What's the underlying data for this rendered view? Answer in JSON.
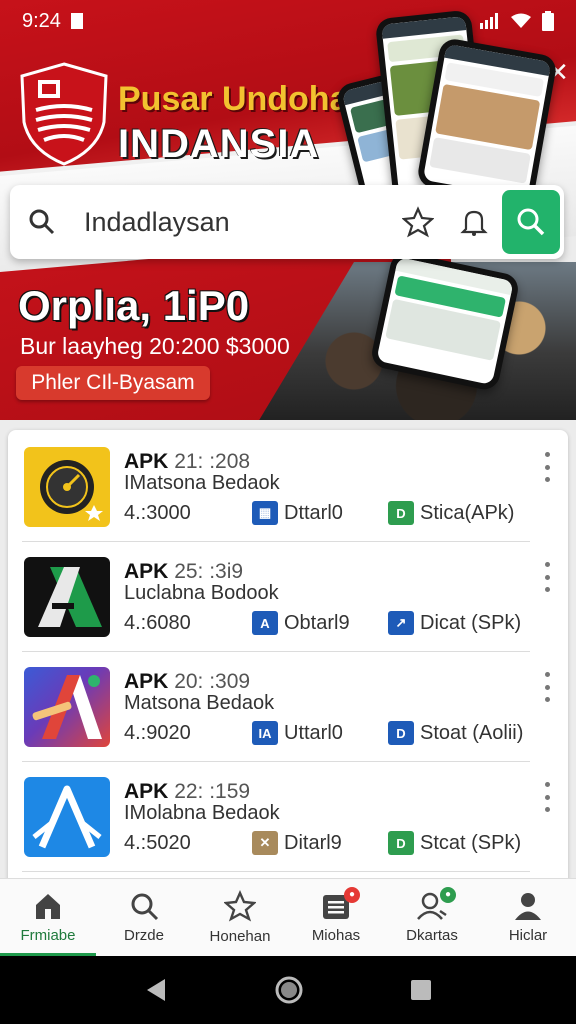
{
  "status_bar": {
    "time": "9:24"
  },
  "hero": {
    "brand_line1": "Pusar Undohan",
    "brand_line2": "INDANSIA",
    "promo_title": "Orplıa, 1iP0",
    "promo_subtitle": "Bur laayheg 20:200 $3000",
    "promo_button": "Phler CIl-Byasam"
  },
  "search": {
    "value": "Indadlaysan"
  },
  "apps": [
    {
      "title": "APK",
      "version": "21: :208",
      "developer": "IMatsona Bedaok",
      "size": "4.:3000",
      "tag1": "Dttarl0",
      "tag2": "Stica(APk)",
      "icon": "compass-icon",
      "icon_color": "#f2c31b"
    },
    {
      "title": "APK",
      "version": "25: :3i9",
      "developer": "Luclabna Bodook",
      "size": "4.:6080",
      "tag1": "Obtarl9",
      "tag2": "Dicat (SPk)",
      "icon": "letter-a-icon",
      "icon_color": "#111111"
    },
    {
      "title": "APK",
      "version": "20: :309",
      "developer": "Matsona Bedaok",
      "size": "4.:9020",
      "tag1": "Uttarl0",
      "tag2": "Stoat (Aolii)",
      "icon": "letter-a-gradient-icon",
      "icon_color": "#e0453a"
    },
    {
      "title": "APK",
      "version": "22: :159",
      "developer": "IMolabna Bedaok",
      "size": "4.:5020",
      "tag1": "Ditarl9",
      "tag2": "Stcat (SPk)",
      "icon": "letter-a-outline-icon",
      "icon_color": "#1e88e5"
    }
  ],
  "bottom_nav": [
    {
      "label": "Frmiabe",
      "icon": "home-icon",
      "active": true
    },
    {
      "label": "Drzde",
      "icon": "search-icon"
    },
    {
      "label": "Honehan",
      "icon": "star-icon"
    },
    {
      "label": "Miohas",
      "icon": "list-icon",
      "badge_color": "#e53935"
    },
    {
      "label": "Dkartas",
      "icon": "user-group-icon",
      "badge_color": "#2e9d4f"
    },
    {
      "label": "Hiclar",
      "icon": "person-icon"
    }
  ],
  "colors": {
    "flag_red": "#c8121a",
    "accent_green": "#22b36b",
    "promo_red": "#d83a2d"
  }
}
